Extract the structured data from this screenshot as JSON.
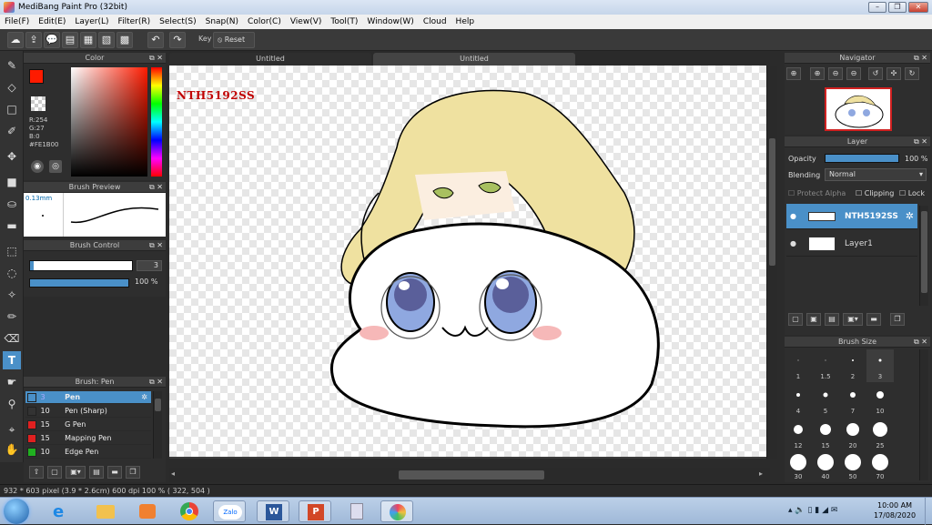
{
  "window": {
    "title": "MediBang Paint Pro (32bit)"
  },
  "menu": [
    "File(F)",
    "Edit(E)",
    "Layer(L)",
    "Filter(R)",
    "Select(S)",
    "Snap(N)",
    "Color(C)",
    "View(V)",
    "Tool(T)",
    "Window(W)",
    "Cloud",
    "Help"
  ],
  "toolbar": {
    "key_label": "Key",
    "reset_label": "Reset"
  },
  "color_panel": {
    "title": "Color",
    "r": "R:254",
    "g": "G:27",
    "b": "B:0",
    "hex": "#FE1B00",
    "primary_color": "#FE1B00"
  },
  "brush_preview": {
    "title": "Brush Preview",
    "size": "0.13mm"
  },
  "brush_control": {
    "title": "Brush Control",
    "size_value": "3",
    "opacity_value": "100 %",
    "opacity_fraction": 1.0
  },
  "brush_list": {
    "title": "Brush: Pen",
    "items": [
      {
        "size": "3",
        "name": "Pen",
        "color": "#4a90c8",
        "selected": true
      },
      {
        "size": "10",
        "name": "Pen (Sharp)",
        "color": "#333333",
        "selected": false
      },
      {
        "size": "15",
        "name": "G Pen",
        "color": "#e02020",
        "selected": false
      },
      {
        "size": "15",
        "name": "Mapping Pen",
        "color": "#e02020",
        "selected": false
      },
      {
        "size": "10",
        "name": "Edge Pen",
        "color": "#20b020",
        "selected": false
      }
    ]
  },
  "tabs": [
    "Untitled",
    "Untitled"
  ],
  "canvas": {
    "watermark": "NTH5192SS"
  },
  "navigator": {
    "title": "Navigator"
  },
  "layer_panel": {
    "title": "Layer",
    "opacity_label": "Opacity",
    "opacity_value": "100 %",
    "blending_label": "Blending",
    "blending_value": "Normal",
    "protect_alpha": "Protect Alpha",
    "clipping": "Clipping",
    "lock": "Lock",
    "layers": [
      {
        "name": "NTH5192SS",
        "selected": true
      },
      {
        "name": "Layer1",
        "selected": false
      }
    ]
  },
  "brush_size": {
    "title": "Brush Size",
    "sizes": [
      "1",
      "1.5",
      "2",
      "3",
      "4",
      "5",
      "7",
      "10",
      "12",
      "15",
      "20",
      "25",
      "30",
      "40",
      "50",
      "70"
    ]
  },
  "status": {
    "text": "932 * 603 pixel  (3.9 * 2.6cm)  600 dpi  100 %  ( 322, 504 )"
  },
  "taskbar": {
    "time": "10:00 AM",
    "date": "17/08/2020"
  },
  "colors": {
    "accent": "#4a90c8",
    "canvas_bg": "#3a3a3a",
    "panel_bg": "#2e2e2e"
  }
}
